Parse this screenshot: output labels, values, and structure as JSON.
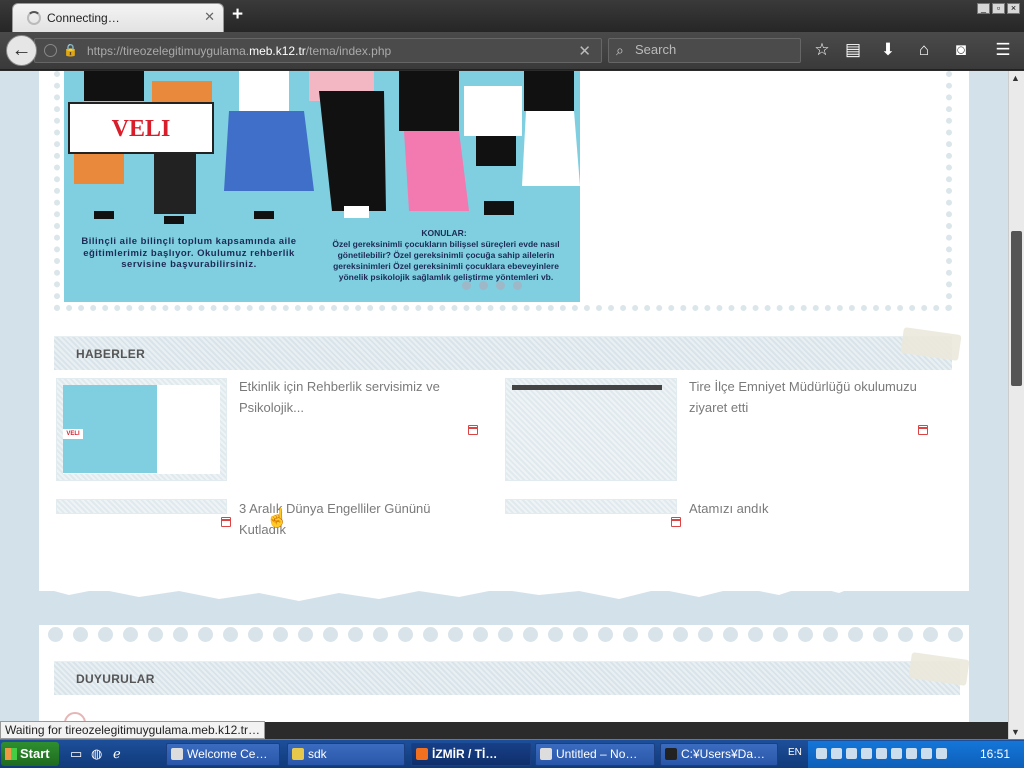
{
  "browser": {
    "tab_title": "Connecting…",
    "url_prefix": "https://tireozelegitimuygulama.",
    "url_domain": "meb.k12.tr",
    "url_path": "/tema/index.php",
    "search_placeholder": "Search",
    "new_tab": "+",
    "tab_close": "✕",
    "url_clear": "✕"
  },
  "poster": {
    "sign_text": "VELI",
    "left_text": "Bilinçli aile bilinçli toplum kapsamında aile eğitimlerimiz başlıyor. Okulumuz rehberlik servisine başvurabilirsiniz.",
    "right_title": "KONULAR:",
    "right_text": "Özel gereksinimli çocukların bilişsel süreçleri evde nasıl gönetilebilir? Özel gereksinimli çocuğa sahip ailelerin gereksinimleri Özel gereksinimli çocuklara ebeveyinlere yönelik psikolojik sağlamlık geliştirme yöntemleri vb."
  },
  "news": {
    "heading": "HABERLER",
    "items": [
      {
        "title": "Etkinlik için Rehberlik servisimiz ve Psikolojik..."
      },
      {
        "title": "Tire İlçe Emniyet Müdürlüğü okulumuzu ziyaret etti"
      },
      {
        "title": "3 Aralık Dünya Engelliler Gününü Kutladık"
      },
      {
        "title": "Atamızı andık"
      }
    ]
  },
  "announcements": {
    "heading": "DUYURULAR"
  },
  "status_text": "Waiting for tireozelegitimuygulama.meb.k12.tr…",
  "taskbar": {
    "start": "Start",
    "tasks": [
      "Welcome Ce…",
      "sdk",
      "İZMİR / Tİ…",
      "Untitled – No…",
      "C:¥Users¥Da…"
    ],
    "lang": "EN",
    "clock": "16:51"
  },
  "colors": {
    "poster_bg": "#7fcfe0",
    "page_bg": "#d3e2ea",
    "accent_red": "#d44444"
  }
}
